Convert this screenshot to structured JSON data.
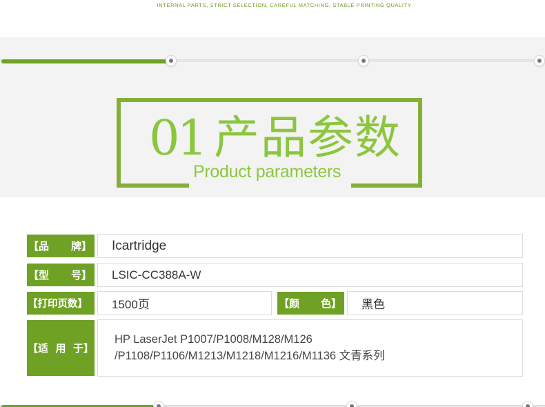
{
  "header": {
    "tagline": "INTERNAL PARTS, STRICT SELECTION, CAREFUL MATCHING, STABLE PRINTING QUALITY"
  },
  "progress_top": {
    "filled_fraction": 0.31,
    "node_count": 3
  },
  "progress_bottom": {
    "filled_fraction": 0.29,
    "node_count": 3
  },
  "section_title": {
    "number": "01",
    "cn": "产品参数",
    "en": "Product parameters"
  },
  "colors": {
    "accent_green": "#6fa124",
    "title_green": "#8cc63e",
    "frame_green": "#84b03a",
    "tagline_green": "#6a9b1e",
    "hero_bg": "#f3f3f3"
  },
  "params": {
    "brand": {
      "label_open": "【品",
      "label_close": "牌】",
      "value": "Icartridge"
    },
    "model": {
      "label_open": "【型",
      "label_close": "号】",
      "value": "LSIC-CC388A-W"
    },
    "pages": {
      "label": "【打印页数】",
      "value": "1500页"
    },
    "color": {
      "label_open": "【颜",
      "label_close": "色】",
      "value": "黑色"
    },
    "compat": {
      "label": "【适  用  于】",
      "line1": "HP LaserJet P1007/P1008/M128/M126",
      "line2": "/P1108/P1106/M1213/M1218/M1216/M1136 文青系列"
    }
  }
}
